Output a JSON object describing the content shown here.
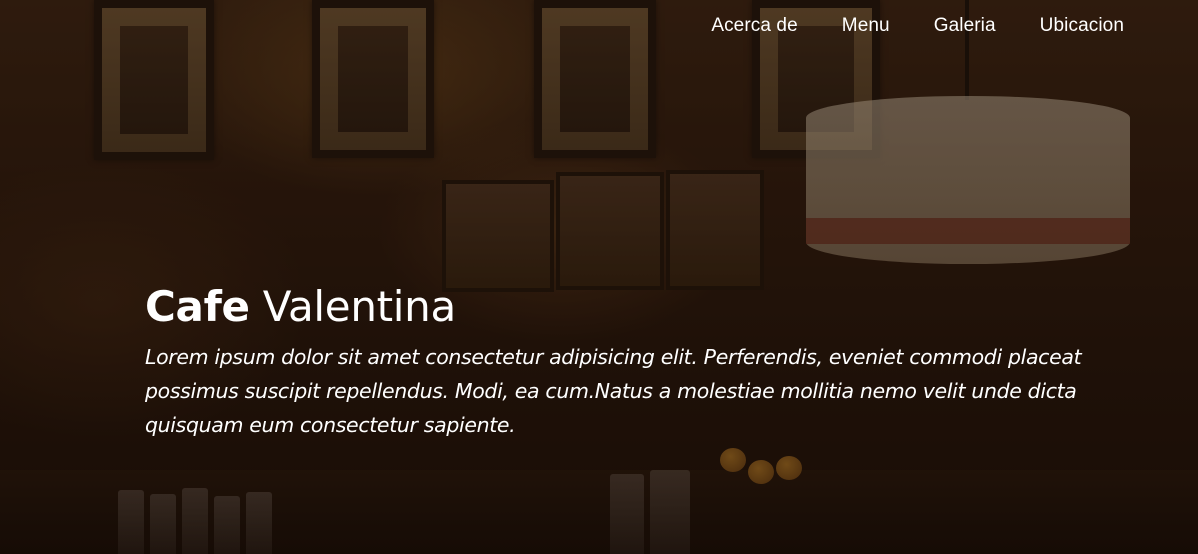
{
  "nav": {
    "items": [
      {
        "label": "Acerca de"
      },
      {
        "label": "Menu"
      },
      {
        "label": "Galeria"
      },
      {
        "label": "Ubicacion"
      }
    ]
  },
  "hero": {
    "title_bold": "Cafe",
    "title_light": "Valentina",
    "tagline": "Lorem ipsum dolor sit amet consectetur adipisicing elit. Perferendis, eveniet commodi placeat possimus suscipit repellendus. Modi, ea cum.Natus a molestiae mollitia nemo velit unde dicta quisquam eum consectetur sapiente."
  },
  "colors": {
    "text": "#ffffff",
    "overlay": "#190c05"
  }
}
